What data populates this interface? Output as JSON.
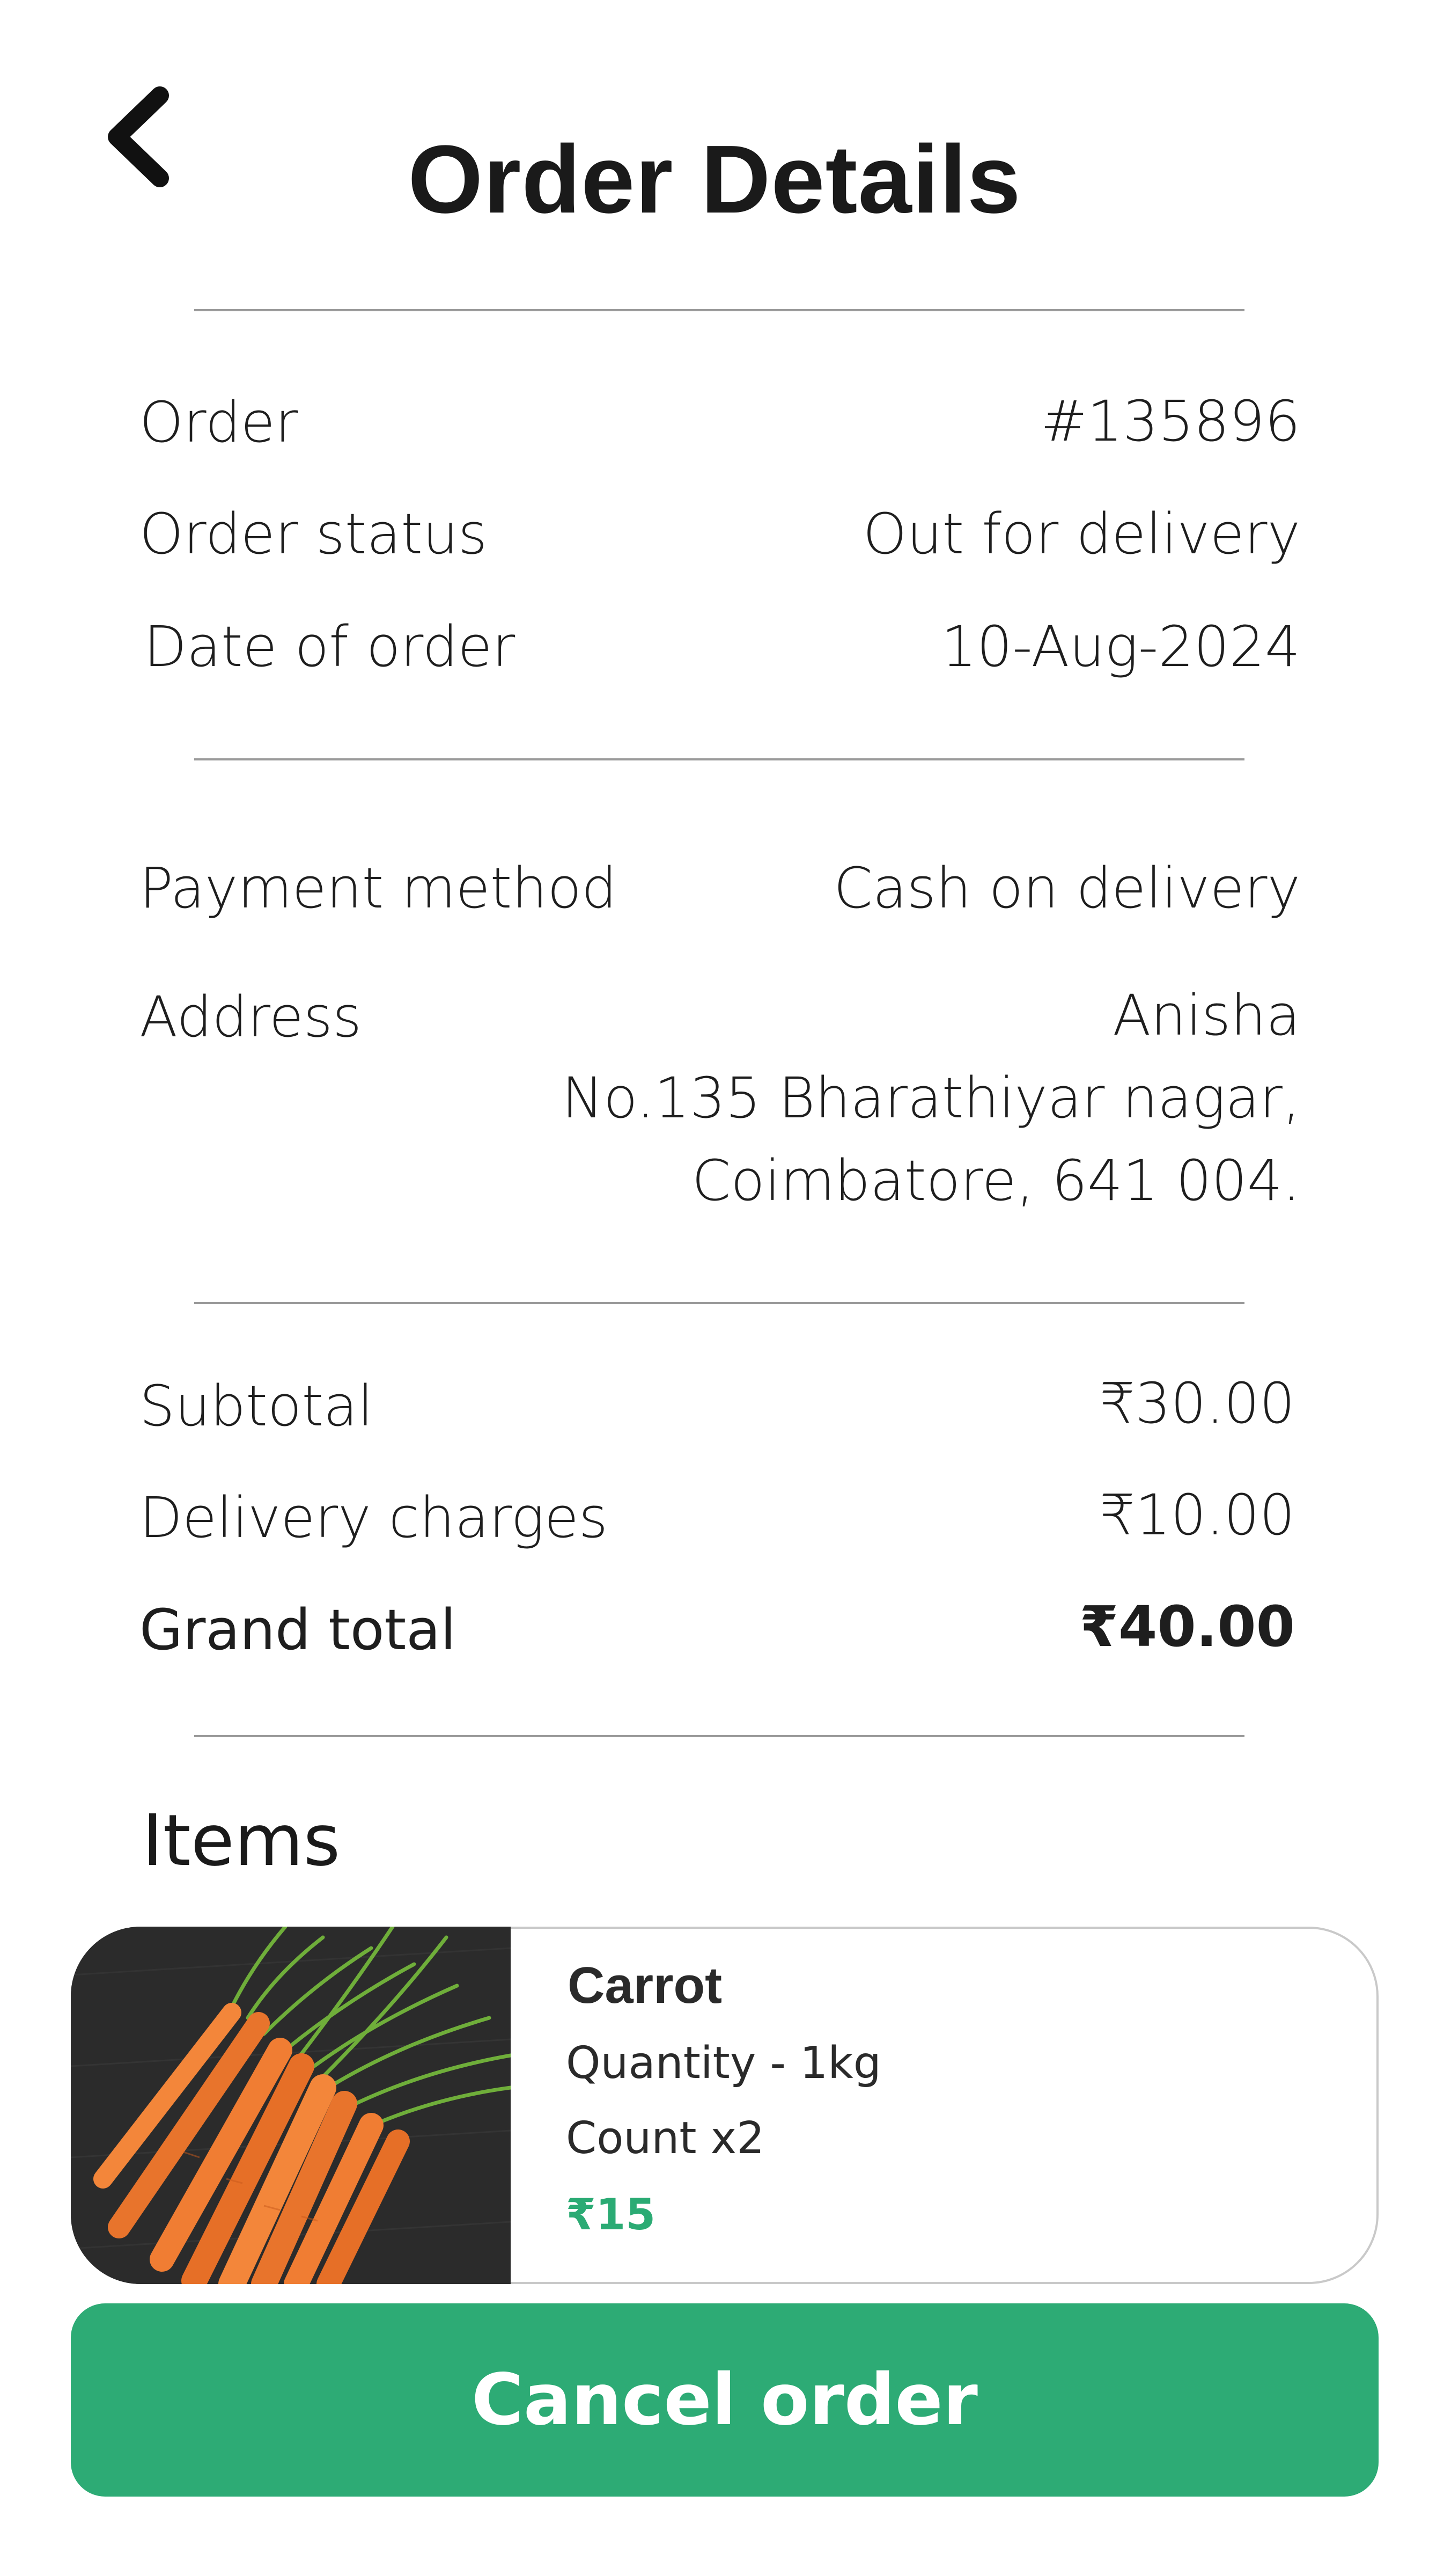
{
  "header": {
    "title": "Order Details",
    "back_icon": "chevron-left-icon"
  },
  "order_info": {
    "order_label": "Order",
    "order_value": "#135896",
    "status_label": "Order status",
    "status_value": "Out for delivery",
    "date_label": "Date of order",
    "date_value": "10-Aug-2024"
  },
  "delivery_info": {
    "payment_label": "Payment method",
    "payment_value": "Cash on delivery",
    "address_label": "Address",
    "address_lines": [
      "Anisha",
      "No.135 Bharathiyar nagar,",
      "Coimbatore, 641 004."
    ]
  },
  "totals": {
    "subtotal_label": "Subtotal",
    "subtotal_value": "₹30.00",
    "delivery_label": "Delivery charges",
    "delivery_value": "₹10.00",
    "grand_label": "Grand total",
    "grand_value": "₹40.00"
  },
  "items": {
    "heading": "Items",
    "list": [
      {
        "name": "Carrot",
        "quantity": "Quantity - 1kg",
        "count": "Count x2",
        "price": "₹15",
        "image_icon": "carrot-image"
      }
    ]
  },
  "actions": {
    "cancel_label": "Cancel order"
  },
  "colors": {
    "accent": "#2dab75",
    "price": "#2bab74",
    "divider": "#9a9a9a",
    "card_border": "#c9c9c9"
  }
}
